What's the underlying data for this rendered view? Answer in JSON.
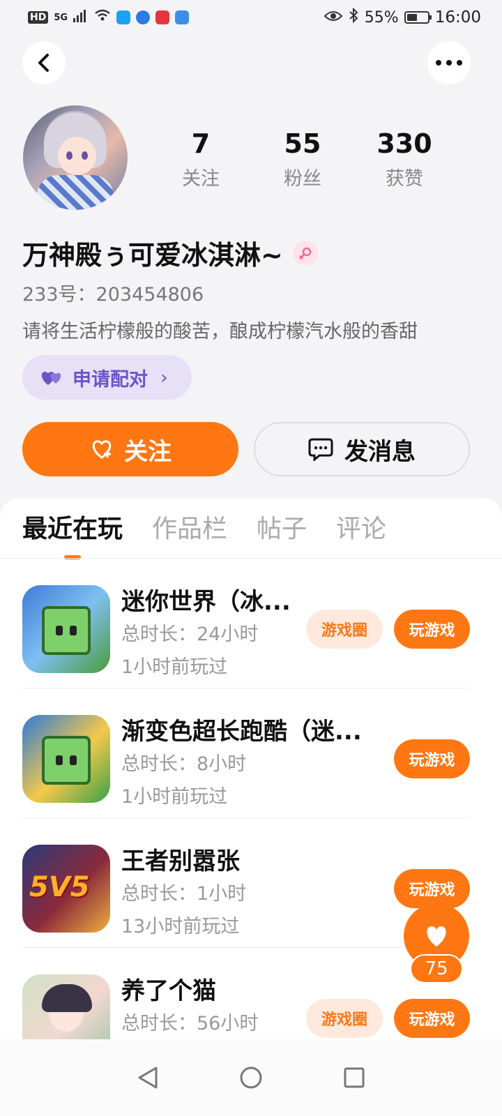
{
  "status_bar": {
    "hd": "HD",
    "network": "5G",
    "battery_pct": "55%",
    "time": "16:00"
  },
  "profile": {
    "stats": [
      {
        "value": "7",
        "label": "关注"
      },
      {
        "value": "55",
        "label": "粉丝"
      },
      {
        "value": "330",
        "label": "获赞"
      }
    ],
    "username": "万神殿ぅ可爱冰淇淋~",
    "id_label": "233号：",
    "id_value": "203454806",
    "bio": "请将生活柠檬般的酸苦，酿成柠檬汽水般的香甜",
    "match_button": "申请配对",
    "follow_button": "关注",
    "message_button": "发消息"
  },
  "tabs": [
    {
      "label": "最近在玩",
      "active": true
    },
    {
      "label": "作品栏",
      "active": false
    },
    {
      "label": "帖子",
      "active": false
    },
    {
      "label": "评论",
      "active": false
    }
  ],
  "games": [
    {
      "title": "迷你世界（冰...",
      "duration": "总时长：24小时",
      "last_played": "1小时前玩过",
      "circle_label": "游戏圈",
      "play_label": "玩游戏"
    },
    {
      "title": "渐变色超长跑酷（迷...",
      "duration": "总时长：8小时",
      "last_played": "1小时前玩过",
      "play_label": "玩游戏"
    },
    {
      "title": "王者别嚣张",
      "duration": "总时长：1小时",
      "last_played": "13小时前玩过",
      "play_label": "玩游戏"
    },
    {
      "title": "养了个猫",
      "duration": "总时长：56小时",
      "last_played": "",
      "circle_label": "游戏圈",
      "play_label": "玩游戏"
    }
  ],
  "game_icon_texts": {
    "wz": "5V5"
  },
  "floating_like": {
    "count": "75"
  },
  "colors": {
    "accent": "#ff7712",
    "match_bg": "#e7e1f8",
    "match_text": "#6a55c8"
  }
}
